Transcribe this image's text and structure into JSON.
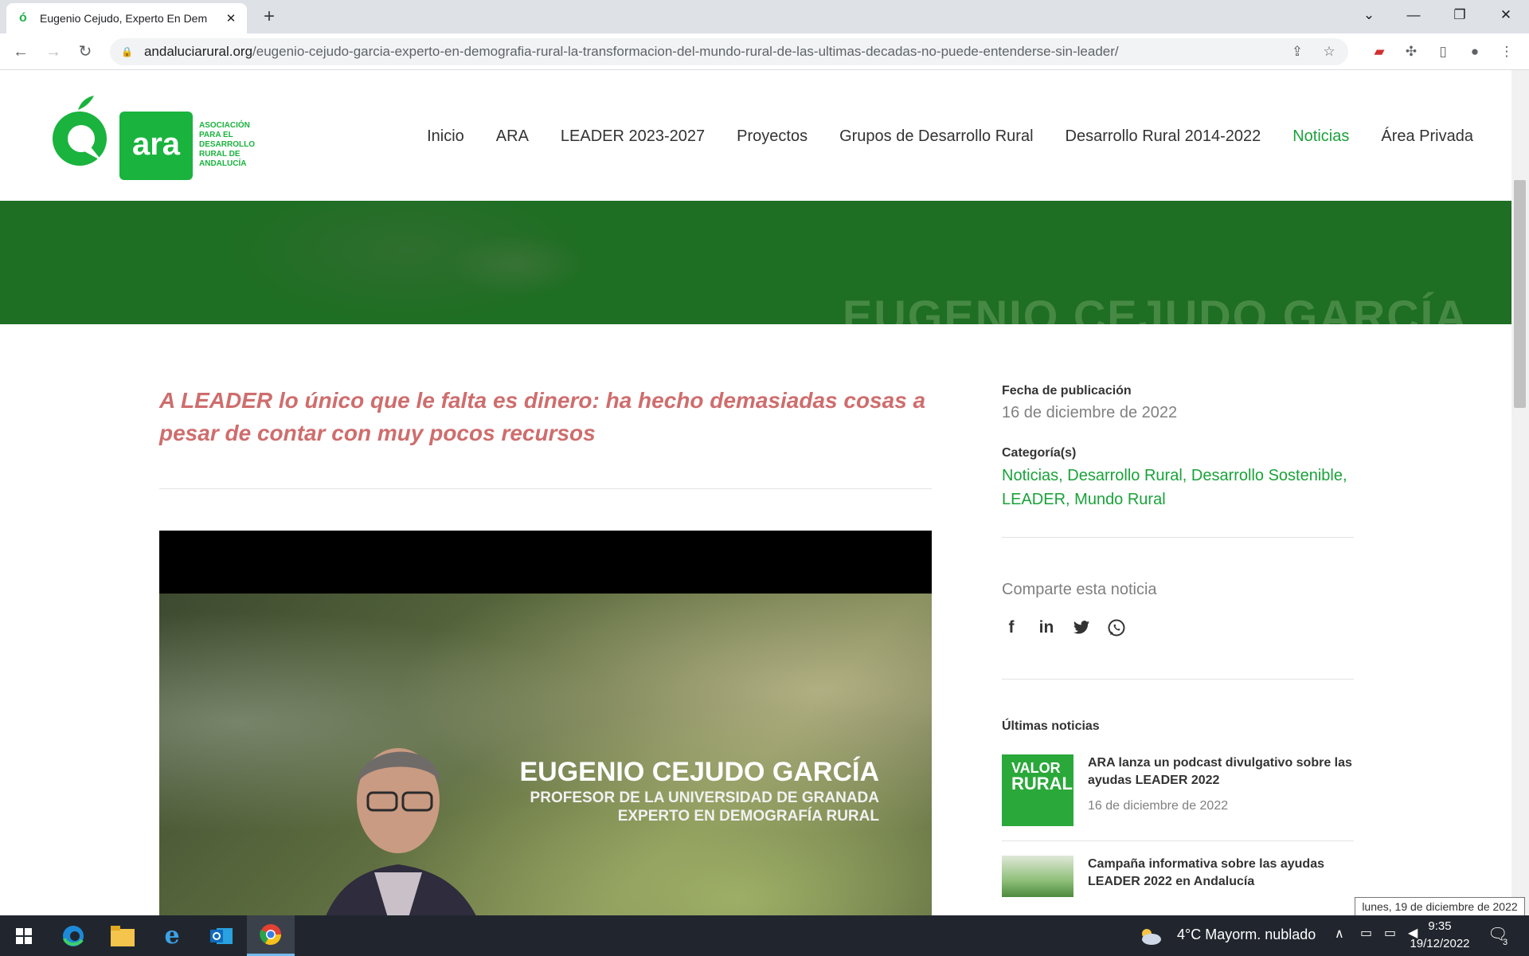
{
  "browser": {
    "tab_title": "Eugenio Cejudo, Experto En Dem",
    "url_domain": "andaluciarural.org",
    "url_path": "/eugenio-cejudo-garcia-experto-en-demografia-rural-la-transformacion-del-mundo-rural-de-las-ultimas-decadas-no-puede-entenderse-sin-leader/"
  },
  "logo": {
    "brand": "ara",
    "lines": [
      "ASOCIACIÓN",
      "PARA EL",
      "DESARROLLO",
      "RURAL DE",
      "ANDALUCÍA"
    ]
  },
  "nav": {
    "items": [
      {
        "label": "Inicio",
        "active": false
      },
      {
        "label": "ARA",
        "active": false
      },
      {
        "label": "LEADER 2023-2027",
        "active": false
      },
      {
        "label": "Proyectos",
        "active": false
      },
      {
        "label": "Grupos de Desarrollo Rural",
        "active": false
      },
      {
        "label": "Desarrollo Rural 2014-2022",
        "active": false
      },
      {
        "label": "Noticias",
        "active": true
      },
      {
        "label": "Área Privada",
        "active": false
      }
    ]
  },
  "banner": {
    "text": "EUGENIO CEJUDO GARCÍA"
  },
  "article": {
    "subtitle": "A LEADER lo único que le falta es dinero: ha hecho demasiadas cosas a pesar de contar con muy pocos recursos",
    "video": {
      "name": "EUGENIO CEJUDO GARCÍA",
      "line1": "PROFESOR DE LA UNIVERSIDAD DE GRANADA",
      "line2": "EXPERTO EN DEMOGRAFÍA RURAL"
    }
  },
  "sidebar": {
    "pub_label": "Fecha de publicación",
    "pub_date": "16 de diciembre de 2022",
    "cat_label": "Categoría(s)",
    "categories": [
      "Noticias",
      "Desarrollo Rural",
      "Desarrollo Sostenible",
      "LEADER",
      "Mundo Rural"
    ],
    "share_label": "Comparte esta noticia",
    "share_icons": [
      "facebook-icon",
      "linkedin-icon",
      "twitter-icon",
      "whatsapp-icon"
    ],
    "latest_label": "Últimas noticias",
    "latest": [
      {
        "title": "ARA lanza un podcast divulgativo sobre las ayudas LEADER 2022",
        "date": "16 de diciembre de 2022",
        "thumb_text": [
          "VALOR",
          "RURAL"
        ]
      },
      {
        "title": "Campaña informativa sobre las ayudas LEADER 2022 en Andalucía",
        "date": ""
      }
    ]
  },
  "taskbar": {
    "weather": "4°C  Mayorm. nublado",
    "time": "9:35",
    "date": "19/12/2022",
    "tooltip": "lunes, 19 de diciembre de 2022",
    "notif_count": "3"
  },
  "colors": {
    "brand_green": "#1aa23a",
    "banner_green": "#1e6e23",
    "subtitle_red": "#cf6d6d"
  }
}
